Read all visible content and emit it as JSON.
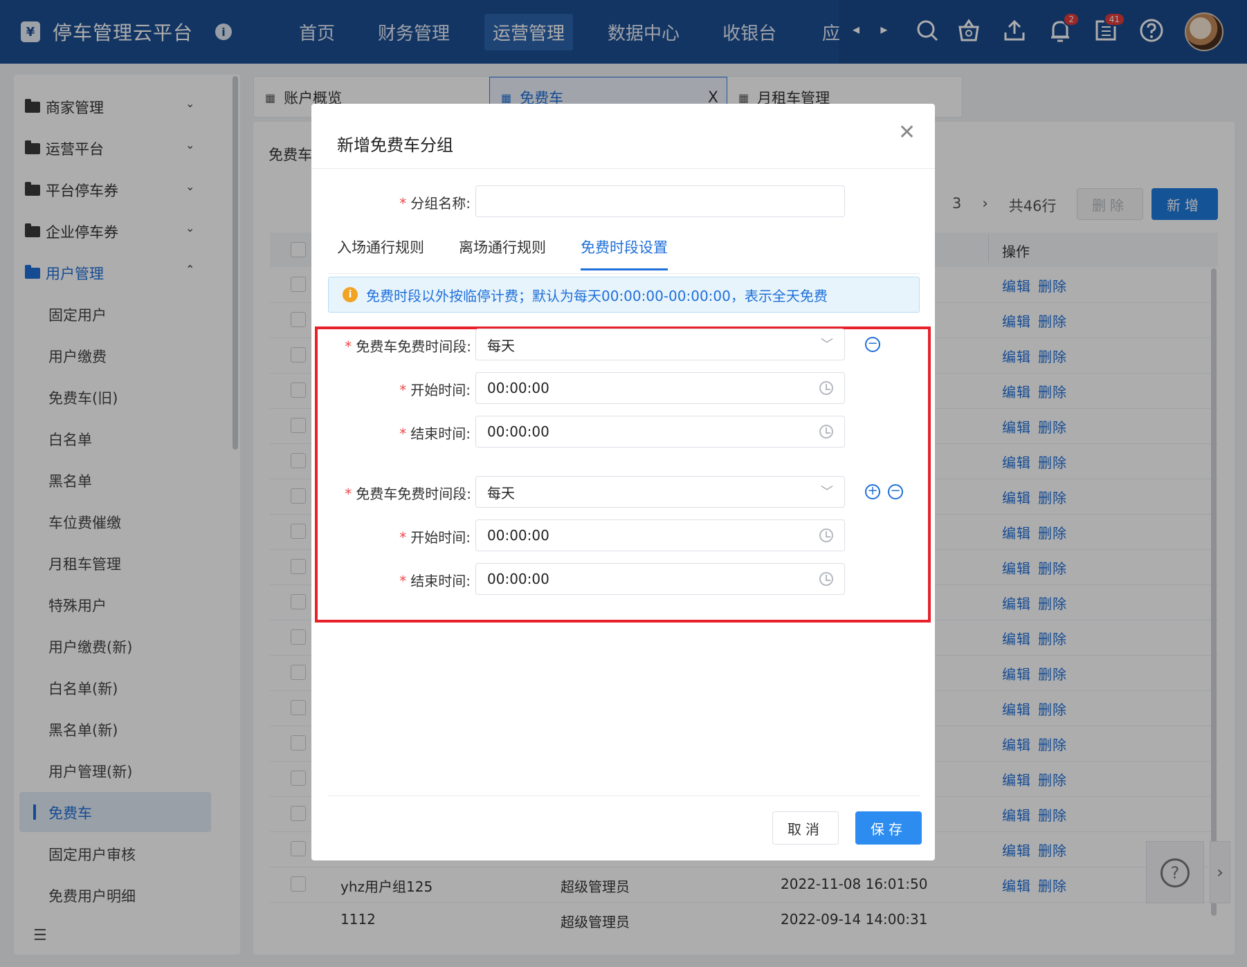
{
  "app": {
    "title": "停车管理云平台",
    "logo_glyph": "¥",
    "info_glyph": "i"
  },
  "nav": {
    "items": [
      "首页",
      "财务管理",
      "运营管理",
      "数据中心",
      "收银台",
      "应"
    ],
    "active": "运营管理"
  },
  "header_icons": {
    "notify_badge": "2",
    "tasks_badge": "41"
  },
  "sidebar": {
    "groups": [
      {
        "label": "商家管理",
        "chevron": "⌄"
      },
      {
        "label": "运营平台",
        "chevron": "⌄"
      },
      {
        "label": "平台停车券",
        "chevron": "⌄"
      },
      {
        "label": "企业停车券",
        "chevron": "⌄"
      },
      {
        "label": "用户管理",
        "chevron": "⌃"
      }
    ],
    "items": [
      "固定用户",
      "用户缴费",
      "免费车(旧)",
      "白名单",
      "黑名单",
      "车位费催缴",
      "月租车管理",
      "特殊用户",
      "用户缴费(新)",
      "白名单(新)",
      "黑名单(新)",
      "用户管理(新)",
      "免费车",
      "固定用户审核",
      "免费用户明细"
    ],
    "active": "免费车"
  },
  "tabs": [
    {
      "label": "账户概览"
    },
    {
      "label": "免费车",
      "close": "X"
    },
    {
      "label": "月租车管理"
    }
  ],
  "page": {
    "breadcrumb": "免费车",
    "pager_page": "3",
    "pager_next": "›",
    "pager_total": "共46行",
    "delete_label": "删除",
    "add_label": "新增",
    "ops_header": "操作",
    "edit_label": "编辑",
    "remove_label": "删除",
    "visible_rows": [
      {
        "name": "yhz用户组125",
        "creator": "超级管理员",
        "time": "2022-11-08 16:01:50"
      },
      {
        "name": "1112",
        "creator": "超级管理员",
        "time": "2022-09-14 14:00:31"
      }
    ]
  },
  "modal": {
    "title": "新增免费车分组",
    "close_glyph": "✕",
    "group_name_label": "分组名称:",
    "group_name_value": "",
    "tabs": [
      "入场通行规则",
      "离场通行规则",
      "免费时段设置"
    ],
    "active_tab": "免费时段设置",
    "alert": "免费时段以外按临停计费；默认为每天00:00:00-00:00:00，表示全天免费",
    "periods": [
      {
        "period_label": "免费车免费时间段:",
        "period_value": "每天",
        "start_label": "开始时间:",
        "start_value": "00:00:00",
        "end_label": "结束时间:",
        "end_value": "00:00:00"
      },
      {
        "period_label": "免费车免费时间段:",
        "period_value": "每天",
        "start_label": "开始时间:",
        "start_value": "00:00:00",
        "end_label": "结束时间:",
        "end_value": "00:00:00"
      }
    ],
    "cancel_label": "取消",
    "save_label": "保存"
  },
  "colors": {
    "header": "#1c4f93",
    "primary": "#1f6fd9",
    "highlight": "#e8202a"
  }
}
